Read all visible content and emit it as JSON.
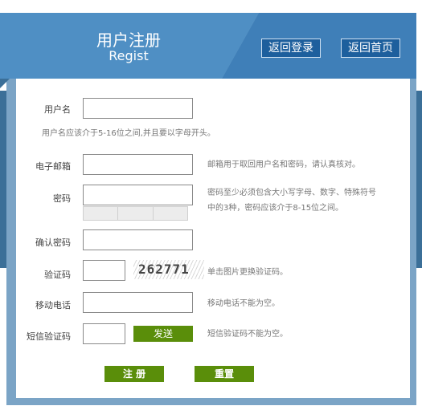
{
  "header": {
    "title_cn": "用户注册",
    "title_en": "Regist",
    "back_login": "返回登录",
    "back_home": "返回首页"
  },
  "form": {
    "username": {
      "label": "用户名",
      "value": "",
      "hint": "用户名应该介于5-16位之间,并且要以字母开头。"
    },
    "email": {
      "label": "电子邮箱",
      "value": "",
      "hint": "邮箱用于取回用户名和密码，请认真核对。"
    },
    "password": {
      "label": "密码",
      "value": "",
      "hint": "密码至少必须包含大小写字母、数字、特殊符号中的3种，密码应该介于8-15位之间。"
    },
    "confirm": {
      "label": "确认密码",
      "value": ""
    },
    "captcha": {
      "label": "验证码",
      "value": "",
      "image_text": "262771",
      "hint": "单击图片更换验证码。"
    },
    "phone": {
      "label": "移动电话",
      "value": "",
      "hint": "移动电话不能为空。"
    },
    "sms": {
      "label": "短信验证码",
      "value": "",
      "send": "发送",
      "hint": "短信验证码不能为空。"
    }
  },
  "actions": {
    "register": "注 册",
    "reset": "重置"
  },
  "colors": {
    "header": "#4f8fc4",
    "header_buttons": "#1d5f9d",
    "band": "#3b6f98",
    "green": "#5a8e0a"
  }
}
